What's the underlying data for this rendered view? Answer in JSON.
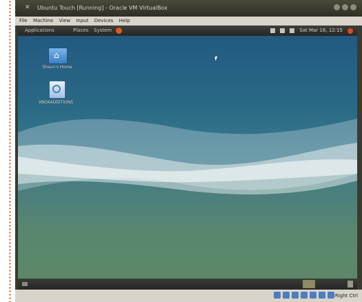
{
  "host_window": {
    "title": "Ubuntu Touch [Running] - Oracle VM VirtualBox",
    "menu": [
      "File",
      "Machine",
      "View",
      "Input",
      "Devices",
      "Help"
    ],
    "host_key": "Right Ctrl"
  },
  "guest": {
    "panel": {
      "applications": "Applications",
      "places": "Places",
      "system": "System",
      "clock": "Sat Mar 16, 12:15"
    },
    "desktop_icons": [
      {
        "label": "Shaun's Home",
        "icon": "home-folder-icon"
      },
      {
        "label": "VBOXADDITIONS",
        "icon": "cd-drive-icon"
      }
    ]
  },
  "colors": {
    "accent": "#e05a25",
    "desktop_top": "#225a80",
    "desktop_bottom": "#5c8868"
  }
}
